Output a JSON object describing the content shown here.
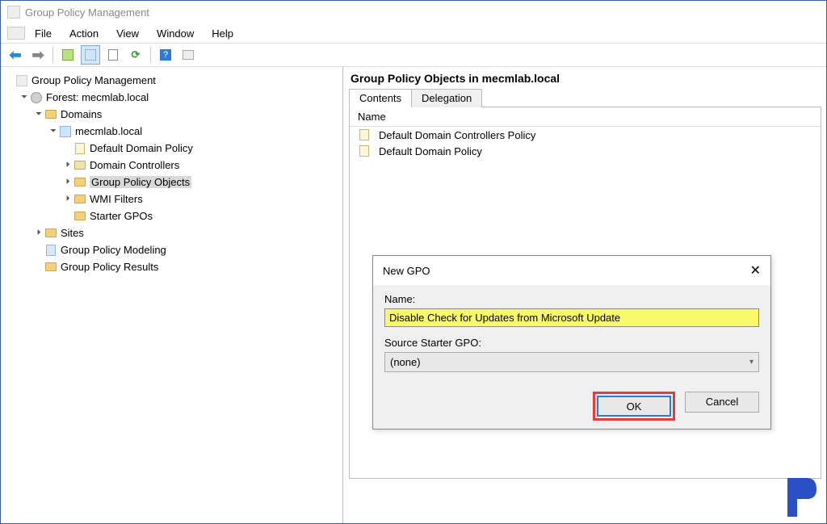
{
  "window": {
    "title": "Group Policy Management"
  },
  "menu": {
    "file": "File",
    "action": "Action",
    "view": "View",
    "window": "Window",
    "help": "Help"
  },
  "tree": {
    "root": "Group Policy Management",
    "forest": "Forest: mecmlab.local",
    "domains": "Domains",
    "domain_name": "mecmlab.local",
    "default_policy": "Default Domain Policy",
    "domain_controllers": "Domain Controllers",
    "gpo": "Group Policy Objects",
    "wmi": "WMI Filters",
    "starter": "Starter GPOs",
    "sites": "Sites",
    "modeling": "Group Policy Modeling",
    "results": "Group Policy Results"
  },
  "content": {
    "title": "Group Policy Objects in mecmlab.local",
    "tab_contents": "Contents",
    "tab_delegation": "Delegation",
    "col_name": "Name",
    "rows": [
      "Default Domain Controllers Policy",
      "Default Domain Policy"
    ]
  },
  "dialog": {
    "title": "New GPO",
    "name_label": "Name:",
    "name_value": "Disable Check for Updates from Microsoft Update",
    "starter_label": "Source Starter GPO:",
    "starter_value": "(none)",
    "ok": "OK",
    "cancel": "Cancel"
  }
}
